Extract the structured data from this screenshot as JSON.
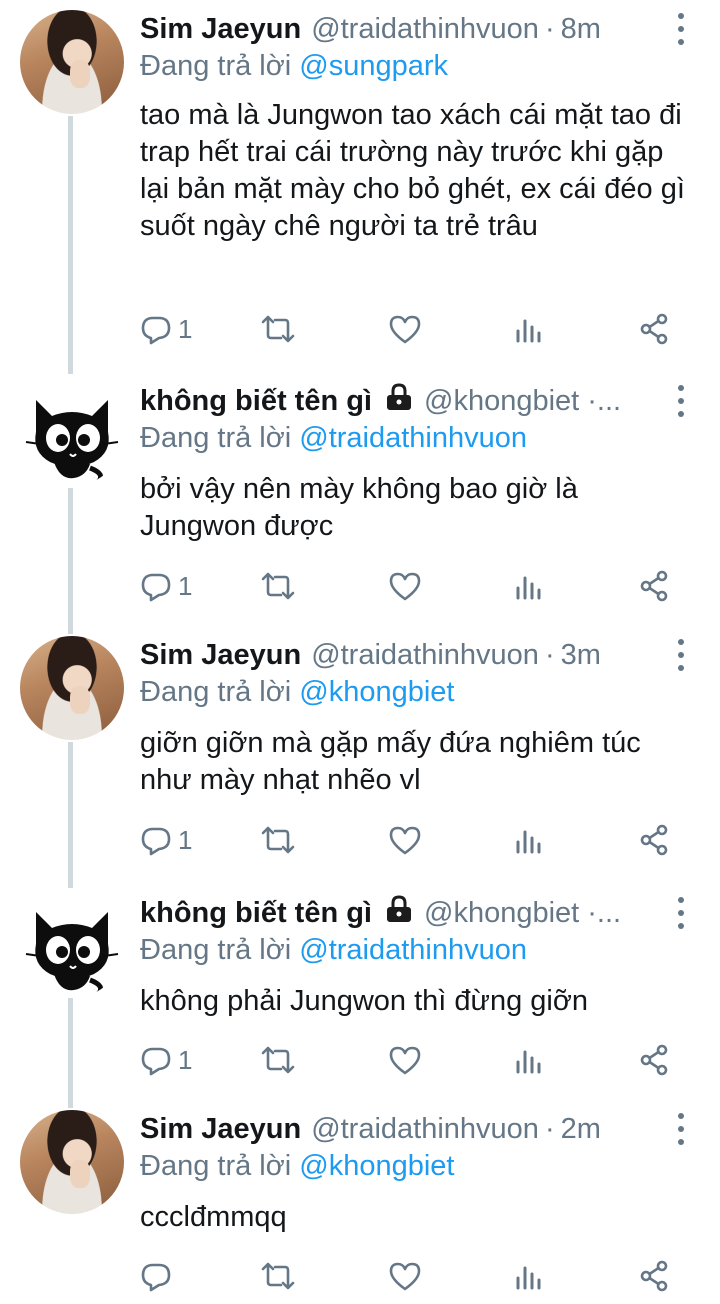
{
  "tweets": [
    {
      "name": "Sim Jaeyun",
      "handle": "@traidathinhvuon",
      "dot": "·",
      "time": "8m",
      "reply_prefix": "Đang trả lời ",
      "mention": "@sungpark",
      "text": "tao mà là Jungwon tao xách cái mặt tao đi trap hết trai cái trường này trước khi gặp lại bản mặt mày cho bỏ ghét, ex cái đéo gì suốt ngày chê người ta trẻ trâu",
      "reply_count": "1",
      "avatar": "selfie-photo"
    },
    {
      "name": "không biết tên gì",
      "handle": "@khongbiet ·...",
      "time": "",
      "reply_prefix": "Đang trả lời ",
      "mention": "@traidathinhvuon",
      "text": "bởi vậy nên mày không bao giờ là Jungwon được",
      "reply_count": "1",
      "avatar": "black-cat",
      "locked": true
    },
    {
      "name": "Sim Jaeyun",
      "handle": "@traidathinhvuon",
      "dot": "·",
      "time": "3m",
      "reply_prefix": "Đang trả lời ",
      "mention": "@khongbiet",
      "text": "giỡn giỡn mà gặp mấy đứa nghiêm túc như mày nhạt nhẽo vl",
      "reply_count": "1",
      "avatar": "selfie-photo"
    },
    {
      "name": "không biết tên gì",
      "handle": "@khongbiet ·...",
      "time": "",
      "reply_prefix": "Đang trả lời ",
      "mention": "@traidathinhvuon",
      "text": "không phải Jungwon thì đừng giỡn",
      "reply_count": "1",
      "avatar": "black-cat",
      "locked": true
    },
    {
      "name": "Sim Jaeyun",
      "handle": "@traidathinhvuon",
      "dot": "·",
      "time": "2m",
      "reply_prefix": "Đang trả lời ",
      "mention": "@khongbiet",
      "text": "ccclđmmqq",
      "reply_count": "",
      "avatar": "selfie-photo"
    }
  ],
  "icons": {
    "reply": "reply-icon",
    "retweet": "retweet-icon",
    "like": "heart-icon",
    "analytics": "analytics-icon",
    "share": "share-icon",
    "more": "more-vertical-icon",
    "lock": "lock-icon"
  },
  "colors": {
    "text": "#14171a",
    "secondary": "#657786",
    "mention": "#1d9bf0",
    "thread_line": "#cfd9de"
  }
}
